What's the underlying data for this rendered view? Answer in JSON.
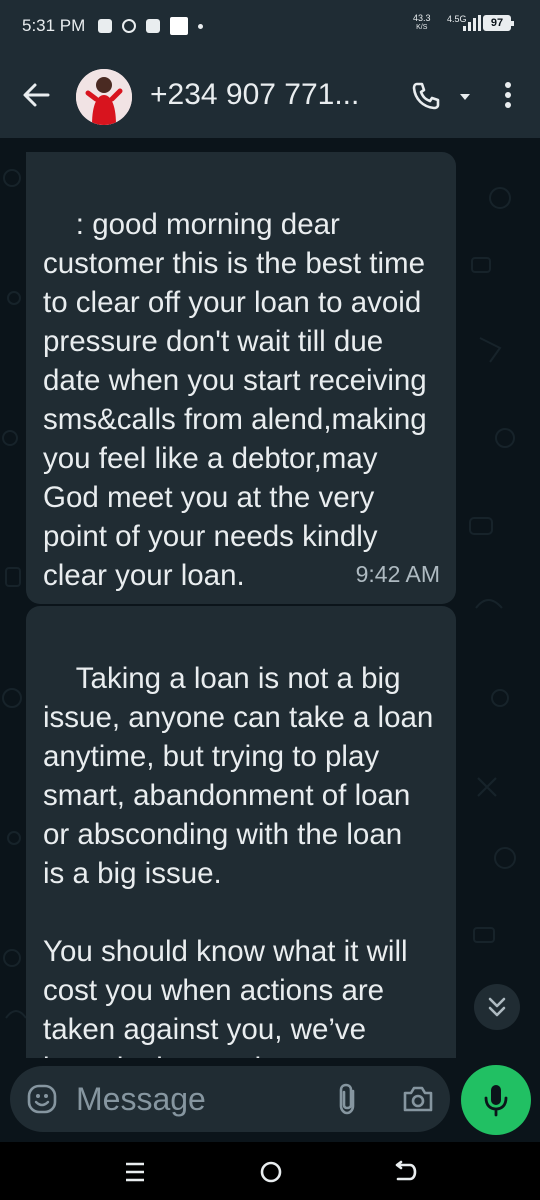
{
  "status_bar": {
    "time": "5:31 PM",
    "net_speed": "43.3",
    "net_unit": "K/S",
    "network_type": "4.5G",
    "battery": "97",
    "icons": [
      "chat-bubble-icon",
      "whatsapp-icon",
      "facebook-icon",
      "square-notification-icon",
      "dot-icon"
    ]
  },
  "header": {
    "contact_name": "+234 907 771...",
    "icons": {
      "back": "back-arrow-icon",
      "call": "phone-icon",
      "call_dropdown": "caret-down-icon",
      "menu": "more-vert-icon"
    }
  },
  "messages": [
    {
      "text": ": good morning dear customer this is the best time to clear off your loan to avoid pressure don't wait till due date when you start receiving sms&calls from alend,making you feel like a debtor,may God meet you at the very point of your needs kindly clear your loan.",
      "time": "9:42 AM"
    },
    {
      "text": "Taking a loan is not a big issue, anyone can take a loan anytime, but trying to play smart, abandonment of loan or absconding with the loan  is a big issue.\n\nYou should know what it will cost you when actions are taken against you, we’ve been lenient and"
    }
  ],
  "composer": {
    "placeholder": "Message",
    "icons": {
      "emoji": "emoji-icon",
      "attach": "paperclip-icon",
      "camera": "camera-icon",
      "mic": "mic-icon"
    }
  },
  "colors": {
    "background": "#0b141a",
    "header": "#1f2c34",
    "bubble_incoming": "#202c33",
    "accent_green": "#21c063",
    "timestamp": "#aebac1"
  },
  "navbar": {
    "icons": [
      "recent-apps-icon",
      "home-icon",
      "back-nav-icon"
    ]
  }
}
